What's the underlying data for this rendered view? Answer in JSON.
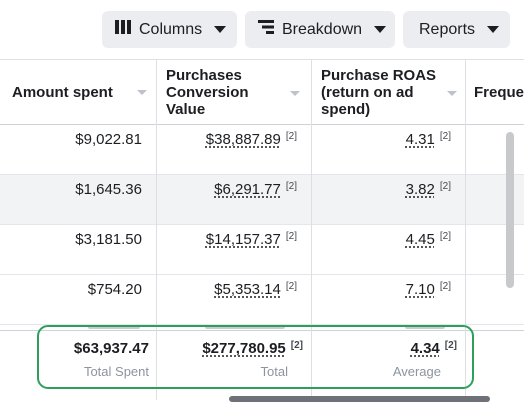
{
  "toolbar": {
    "columns_label": "Columns",
    "breakdown_label": "Breakdown",
    "reports_label": "Reports"
  },
  "table": {
    "headers": {
      "amount_spent": "Amount spent",
      "purchases_value": [
        "Purchases",
        "Conversion",
        "Value"
      ],
      "purchase_roas": [
        "Purchase ROAS",
        "(return on ad",
        "spend)"
      ],
      "frequency": "Freque"
    },
    "footnote": "[2]",
    "rows": [
      {
        "amount_spent": "$9,022.81",
        "purchases_value": "$38,887.89",
        "roas": "4.31"
      },
      {
        "amount_spent": "$1,645.36",
        "purchases_value": "$6,291.77",
        "roas": "3.82"
      },
      {
        "amount_spent": "$3,181.50",
        "purchases_value": "$14,157.37",
        "roas": "4.45"
      },
      {
        "amount_spent": "$754.20",
        "purchases_value": "$5,353.14",
        "roas": "7.10"
      }
    ],
    "totals": {
      "amount_spent": "$63,937.47",
      "amount_spent_label": "Total Spent",
      "purchases_value": "$277,780.95",
      "purchases_value_label": "Total",
      "roas": "4.34",
      "roas_label": "Average"
    }
  },
  "colors": {
    "highlight": "#2e9e5b",
    "row_alt": "#f2f3f5",
    "button_bg": "#ebedf0"
  }
}
